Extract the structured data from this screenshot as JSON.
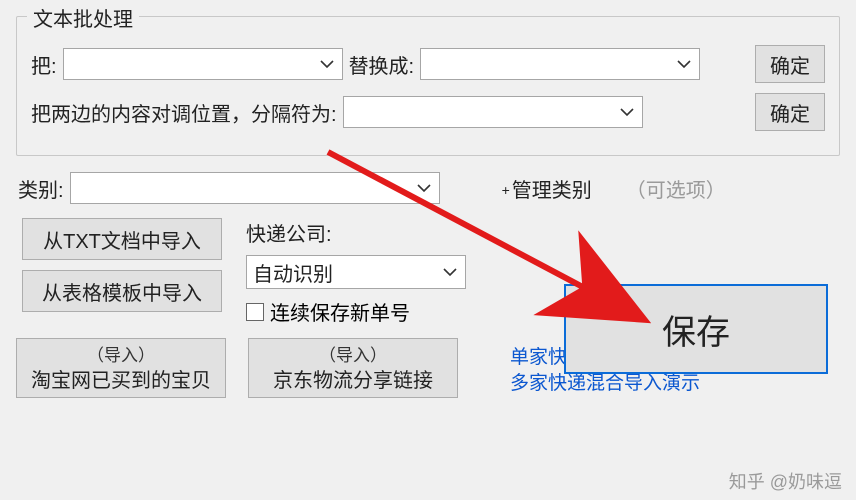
{
  "group": {
    "title": "文本批处理",
    "from_label": "把:",
    "to_label": "替换成:",
    "confirm": "确定",
    "swap_label": "把两边的内容对调位置，分隔符为:",
    "confirm2": "确定"
  },
  "category": {
    "label": "类别:",
    "manage": "管理类别",
    "optional": "（可选项）"
  },
  "import": {
    "from_txt": "从TXT文档中导入",
    "from_template": "从表格模板中导入"
  },
  "express": {
    "label": "快递公司:",
    "selected": "自动识别",
    "continuous_save": "连续保存新单号"
  },
  "save": "保存",
  "bottom": {
    "import_hint": "（导入）",
    "taobao": "淘宝网已买到的宝贝",
    "jd": "京东物流分享链接"
  },
  "links": {
    "single": "单家快递单号导入演示",
    "multi": "多家快递混合导入演示"
  },
  "watermark": "知乎 @奶味逗"
}
